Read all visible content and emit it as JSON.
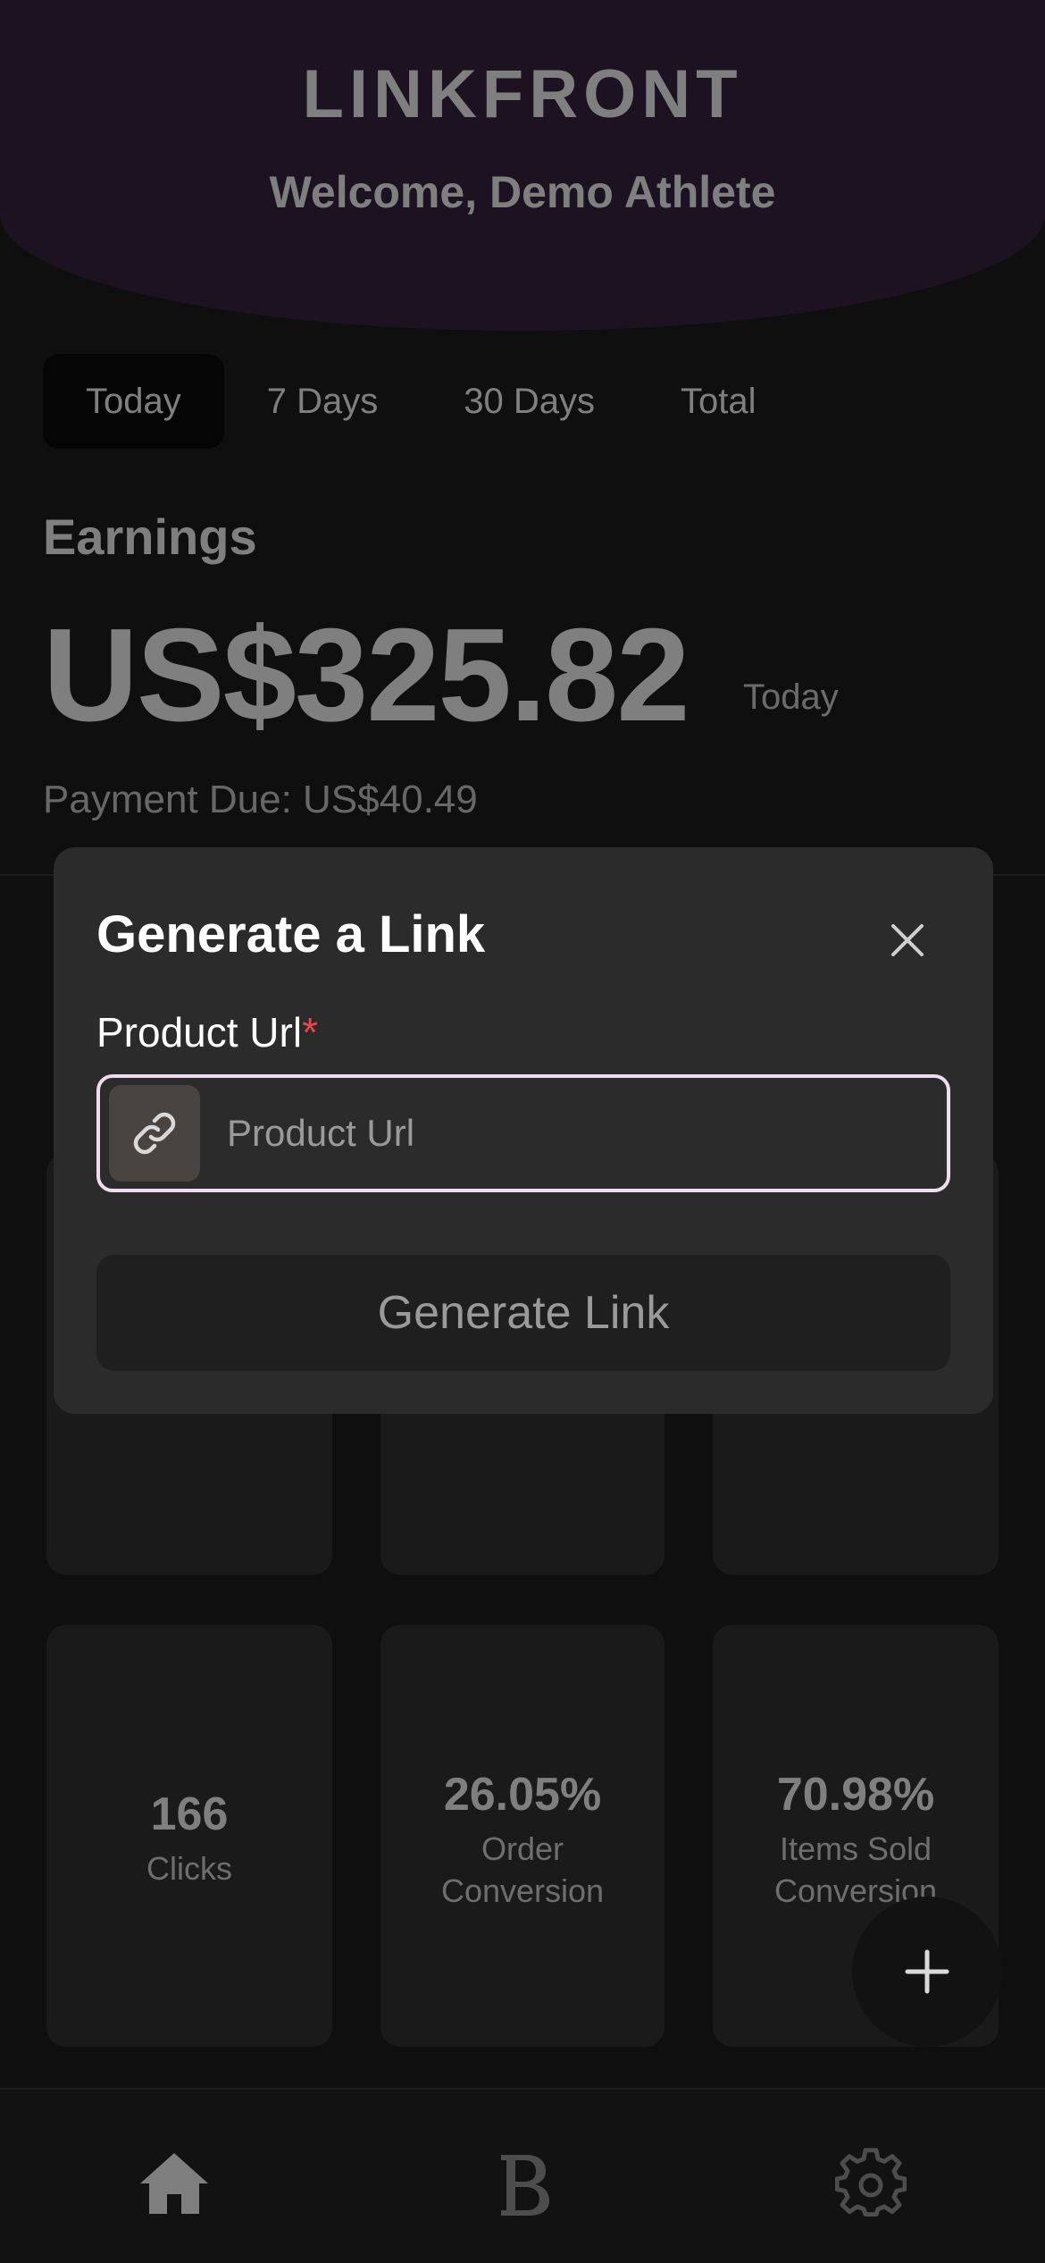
{
  "header": {
    "brand": "LINKFRONT",
    "welcome": "Welcome, Demo Athlete"
  },
  "tabs": [
    {
      "label": "Today",
      "active": true
    },
    {
      "label": "7 Days",
      "active": false
    },
    {
      "label": "30 Days",
      "active": false
    },
    {
      "label": "Total",
      "active": false
    }
  ],
  "earnings": {
    "label": "Earnings",
    "amount": "US$325.82",
    "period": "Today",
    "payment_due": "Payment Due: US$40.49"
  },
  "stats": [
    {
      "value": "166",
      "label": "Clicks"
    },
    {
      "value": "26.05%",
      "label": "Order Conversion"
    },
    {
      "value": "70.98%",
      "label": "Items Sold Conversion"
    }
  ],
  "modal": {
    "title": "Generate a Link",
    "field_label": "Product Url",
    "required_mark": "*",
    "input_value": "",
    "input_placeholder": "Product Url",
    "button_label": "Generate Link"
  },
  "icons": {
    "close": "close-icon",
    "link": "link-icon",
    "plus": "plus-icon",
    "home": "home-icon",
    "bookings": "b-letter-icon",
    "settings": "gear-icon"
  },
  "colors": {
    "header_bg": "#3a2445",
    "input_border": "#efdcf0",
    "required": "#e5484d",
    "background": "#1f1f1f"
  }
}
